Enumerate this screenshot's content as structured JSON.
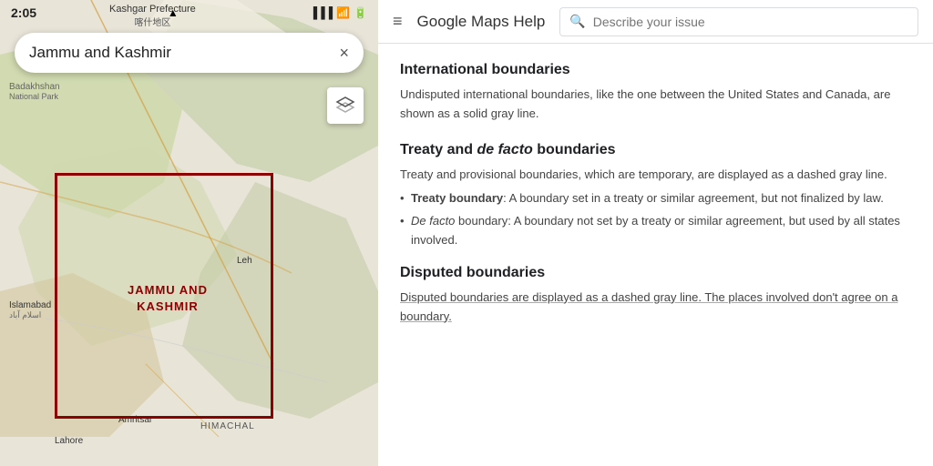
{
  "phone": {
    "status_time": "2:05",
    "search_text": "Jammu and Kashmir",
    "close_button": "×",
    "kashmir_label_line1": "JAMMU AND",
    "kashmir_label_line2": "KASHMIR",
    "kashgar_label": "Kashgar Prefecture",
    "kashgar_chinese": "喀什地区",
    "city_islamabad": "Islamabad",
    "city_islamabad_ur": "اسلام آباد",
    "city_amritsar": "Amritsar",
    "city_lahore": "Lahore",
    "city_leh": "Leh",
    "region_himachal": "HIMACHAL",
    "region_badakhshan": "Badakhshan",
    "region_national_park": "National Park",
    "layer_icon": "⧉"
  },
  "help": {
    "hamburger_label": "≡",
    "title": "Google Maps Help",
    "search_placeholder": "Describe your issue",
    "sections": [
      {
        "id": "international",
        "title": "International boundaries",
        "body": "Undisputed international boundaries, like the one between the United States and Canada, are shown as a solid gray line.",
        "bullets": []
      },
      {
        "id": "treaty",
        "title_prefix": "Treaty and ",
        "title_italic": "de facto",
        "title_suffix": " boundaries",
        "body": "Treaty and provisional boundaries, which are temporary, are displayed as a dashed gray line.",
        "bullets": [
          {
            "bold": "Treaty boundary",
            "text": ": A boundary set in a treaty or similar agreement, but not finalized by law."
          },
          {
            "bold_italic": "De facto",
            "text": " boundary: A boundary not set by a treaty or similar agreement, but used by all states involved."
          }
        ]
      },
      {
        "id": "disputed",
        "title": "Disputed boundaries",
        "body": "Disputed boundaries are displayed as a dashed gray line. The places involved don't agree on a boundary.",
        "underline": true
      }
    ]
  }
}
